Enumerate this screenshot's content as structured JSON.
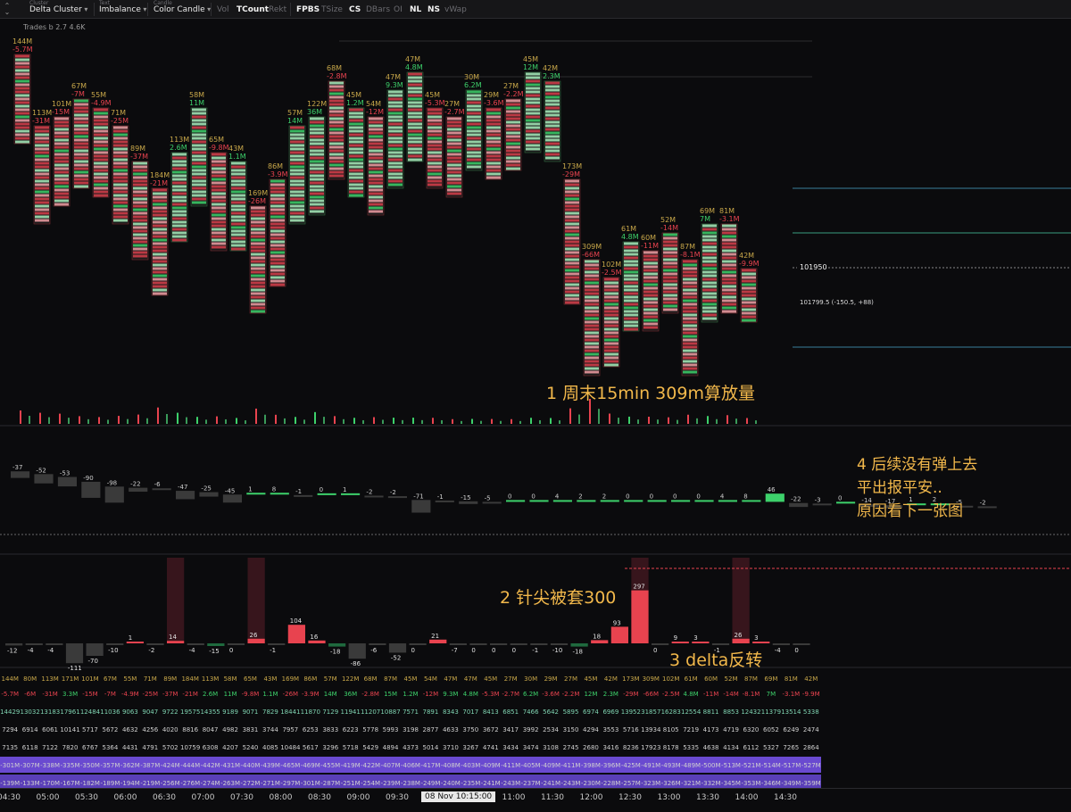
{
  "toolbar": {
    "groups": [
      {
        "caption": "Cluster",
        "value": "Delta Cluster"
      },
      {
        "caption": "Text",
        "value": "Imbalance"
      },
      {
        "caption": "Candle",
        "value": "Color Candle"
      }
    ],
    "toggles": [
      {
        "label": "Vol",
        "active": false
      },
      {
        "label": "TCount",
        "active": true
      },
      {
        "label": "Rekt",
        "active": false
      },
      {
        "label": "FPBS",
        "active": true
      },
      {
        "label": "TSize",
        "active": false
      },
      {
        "label": "CS",
        "active": true
      },
      {
        "label": "DBars",
        "active": false
      },
      {
        "label": "OI",
        "active": false
      },
      {
        "label": "NL",
        "active": true
      },
      {
        "label": "NS",
        "active": true
      },
      {
        "label": "vWap",
        "active": false
      }
    ]
  },
  "legend_text": "Trades b  2.7  4.6K",
  "price_labels": {
    "current": "101950",
    "crosshair": "101799.5 (-150.5, +88)"
  },
  "annotations": {
    "a1": "1 周末15min 309m算放量",
    "a2": "2 针尖被套300",
    "a3": "3 delta反转",
    "a4_line1": "4 后续没有弹上去",
    "a4_line2": "平出报平安..",
    "a4_line3": "原因看下一张图"
  },
  "colors": {
    "up": "#3dd16b",
    "down": "#e8434f",
    "accent": "#f2b84b",
    "purple": "#7d5bd6"
  },
  "chart_data": {
    "type": "footprint",
    "bars": [
      {
        "vol": "144M",
        "delta": "-5.7M",
        "high": 40,
        "low": 140
      },
      {
        "vol": "113M",
        "delta": "-31M",
        "high": 120,
        "low": 230
      },
      {
        "vol": "101M",
        "delta": "-15M",
        "high": 110,
        "low": 210
      },
      {
        "vol": "67M",
        "delta": "-7M",
        "high": 90,
        "low": 190
      },
      {
        "vol": "55M",
        "delta": "-4.9M",
        "high": 100,
        "low": 200
      },
      {
        "vol": "71M",
        "delta": "-25M",
        "high": 120,
        "low": 230
      },
      {
        "vol": "89M",
        "delta": "-37M",
        "high": 160,
        "low": 270
      },
      {
        "vol": "184M",
        "delta": "-21M",
        "high": 190,
        "low": 310
      },
      {
        "vol": "113M",
        "delta": "2.6M",
        "high": 150,
        "low": 250
      },
      {
        "vol": "58M",
        "delta": "11M",
        "high": 100,
        "low": 210
      },
      {
        "vol": "65M",
        "delta": "-9.8M",
        "high": 150,
        "low": 260
      },
      {
        "vol": "43M",
        "delta": "1.1M",
        "high": 160,
        "low": 260
      },
      {
        "vol": "169M",
        "delta": "-26M",
        "high": 210,
        "low": 330
      },
      {
        "vol": "86M",
        "delta": "-3.9M",
        "high": 180,
        "low": 300
      },
      {
        "vol": "57M",
        "delta": "14M",
        "high": 120,
        "low": 230
      },
      {
        "vol": "122M",
        "delta": "36M",
        "high": 110,
        "low": 220
      },
      {
        "vol": "68M",
        "delta": "-2.8M",
        "high": 70,
        "low": 180
      },
      {
        "vol": "45M",
        "delta": "1.2M",
        "high": 100,
        "low": 200
      },
      {
        "vol": "54M",
        "delta": "-12M",
        "high": 110,
        "low": 220
      },
      {
        "vol": "47M",
        "delta": "9.3M",
        "high": 80,
        "low": 190
      },
      {
        "vol": "47M",
        "delta": "4.8M",
        "high": 60,
        "low": 160
      },
      {
        "vol": "45M",
        "delta": "-5.3M",
        "high": 100,
        "low": 190
      },
      {
        "vol": "27M",
        "delta": "-2.7M",
        "high": 110,
        "low": 200
      },
      {
        "vol": "30M",
        "delta": "6.2M",
        "high": 80,
        "low": 170
      },
      {
        "vol": "29M",
        "delta": "-3.6M",
        "high": 100,
        "low": 180
      },
      {
        "vol": "27M",
        "delta": "-2.2M",
        "high": 90,
        "low": 170
      },
      {
        "vol": "45M",
        "delta": "12M",
        "high": 60,
        "low": 150
      },
      {
        "vol": "42M",
        "delta": "2.3M",
        "high": 70,
        "low": 160
      },
      {
        "vol": "173M",
        "delta": "-29M",
        "high": 180,
        "low": 320
      },
      {
        "vol": "309M",
        "delta": "-66M",
        "high": 270,
        "low": 400
      },
      {
        "vol": "102M",
        "delta": "-2.5M",
        "high": 290,
        "low": 390
      },
      {
        "vol": "61M",
        "delta": "4.8M",
        "high": 250,
        "low": 350
      },
      {
        "vol": "60M",
        "delta": "-11M",
        "high": 260,
        "low": 350
      },
      {
        "vol": "52M",
        "delta": "-14M",
        "high": 240,
        "low": 330
      },
      {
        "vol": "87M",
        "delta": "-8.1M",
        "high": 270,
        "low": 400
      },
      {
        "vol": "69M",
        "delta": "7M",
        "high": 230,
        "low": 340
      },
      {
        "vol": "81M",
        "delta": "-3.1M",
        "high": 230,
        "low": 330
      },
      {
        "vol": "42M",
        "delta": "-9.9M",
        "high": 280,
        "low": 340
      }
    ],
    "cvd_values": [
      "-37",
      "-52",
      "-53",
      "-90",
      "-98",
      "-22",
      "-6",
      "-47",
      "-25",
      "-45",
      "1",
      "8",
      "-1",
      "0",
      "1",
      "-2",
      "-2",
      "-71",
      "-1",
      "-15",
      "-5",
      "0",
      "0",
      "4",
      "2",
      "2",
      "0",
      "0",
      "0",
      "0",
      "4",
      "8",
      "46",
      "-22",
      "-3",
      "0",
      "-14",
      "-17",
      "1",
      "2",
      "-5",
      "-2"
    ],
    "delta_values": [
      "-12",
      "-4",
      "-4",
      "-111",
      "-70",
      "-10",
      "1",
      "-2",
      "14",
      "-4",
      "-15",
      "0",
      "26",
      "-1",
      "104",
      "16",
      "-18",
      "-86",
      "-6",
      "-52",
      "0",
      "21",
      "-7",
      "0",
      "0",
      "0",
      "-1",
      "-10",
      "-18",
      "18",
      "93",
      "297",
      "0",
      "9",
      "3",
      "-1",
      "26",
      "3",
      "-4",
      "0"
    ],
    "table": {
      "columns": [
        "144M",
        "80M",
        "113M",
        "171M",
        "101M",
        "67M",
        "55M",
        "71M",
        "89M",
        "184M",
        "113M",
        "58M",
        "65M",
        "43M",
        "169M",
        "86M",
        "57M",
        "122M",
        "68M",
        "87M",
        "45M",
        "54M",
        "47M",
        "47M",
        "45M",
        "27M",
        "30M",
        "29M",
        "27M",
        "45M",
        "42M",
        "173M",
        "309M",
        "102M",
        "61M",
        "60M",
        "52M",
        "87M",
        "69M",
        "81M",
        "42M"
      ],
      "rows": [
        [
          "-5.7M",
          "-6M",
          "-31M",
          "3.3M",
          "-15M",
          "-7M",
          "-4.9M",
          "-25M",
          "-37M",
          "-21M",
          "2.6M",
          "11M",
          "-9.8M",
          "1.1M",
          "-26M",
          "-3.9M",
          "14M",
          "36M",
          "-2.8M",
          "15M",
          "1.2M",
          "-12M",
          "9.3M",
          "4.8M",
          "-5.3M",
          "-2.7M",
          "6.2M",
          "-3.6M",
          "-2.2M",
          "12M",
          "2.3M",
          "-29M",
          "-66M",
          "-2.5M",
          "4.8M",
          "-11M",
          "-14M",
          "-8.1M",
          "7M",
          "-3.1M",
          "-9.9M"
        ],
        [
          "14429",
          "13032",
          "13183",
          "17961",
          "12484",
          "11036",
          "9063",
          "9047",
          "9722",
          "19575",
          "14355",
          "9189",
          "9071",
          "7829",
          "18441",
          "11870",
          "7129",
          "11941",
          "11207",
          "10887",
          "7571",
          "7891",
          "8343",
          "7017",
          "8413",
          "6851",
          "7466",
          "5642",
          "5895",
          "6974",
          "6969",
          "13952",
          "31857",
          "16283",
          "12554",
          "8811",
          "8853",
          "12432",
          "11379",
          "13514",
          "5338"
        ],
        [
          "7294",
          "6914",
          "6061",
          "10141",
          "5717",
          "5672",
          "4632",
          "4256",
          "4020",
          "8816",
          "8047",
          "4982",
          "3831",
          "3744",
          "7957",
          "6253",
          "3833",
          "6223",
          "5778",
          "5993",
          "3198",
          "2877",
          "4633",
          "3750",
          "3672",
          "3417",
          "3992",
          "2534",
          "3150",
          "4294",
          "3553",
          "5716",
          "13934",
          "8105",
          "7219",
          "4173",
          "4719",
          "6320",
          "6052",
          "6249",
          "2474"
        ],
        [
          "7135",
          "6118",
          "7122",
          "7820",
          "6767",
          "5364",
          "4431",
          "4791",
          "5702",
          "10759",
          "6308",
          "4207",
          "5240",
          "4085",
          "10484",
          "5617",
          "3296",
          "5718",
          "5429",
          "4894",
          "4373",
          "5014",
          "3710",
          "3267",
          "4741",
          "3434",
          "3474",
          "3108",
          "2745",
          "2680",
          "3416",
          "8236",
          "17923",
          "8178",
          "5335",
          "4638",
          "4134",
          "6112",
          "5327",
          "7265",
          "2864"
        ],
        [
          "-301M",
          "-307M",
          "-338M",
          "-335M",
          "-350M",
          "-357M",
          "-362M",
          "-387M",
          "-424M",
          "-444M",
          "-442M",
          "-431M",
          "-440M",
          "-439M",
          "-465M",
          "-469M",
          "-455M",
          "-419M",
          "-422M",
          "-407M",
          "-406M",
          "-417M",
          "-408M",
          "-403M",
          "-409M",
          "-411M",
          "-405M",
          "-409M",
          "-411M",
          "-398M",
          "-396M",
          "-425M",
          "-491M",
          "-493M",
          "-489M",
          "-500M",
          "-513M",
          "-521M",
          "-514M",
          "-517M",
          "-527M"
        ],
        [
          "-139M",
          "-133M",
          "-170M",
          "-167M",
          "-182M",
          "-189M",
          "-194M",
          "-219M",
          "-256M",
          "-276M",
          "-274M",
          "-263M",
          "-272M",
          "-271M",
          "-297M",
          "-301M",
          "-287M",
          "-251M",
          "-254M",
          "-239M",
          "-238M",
          "-249M",
          "-240M",
          "-235M",
          "-241M",
          "-243M",
          "-237M",
          "-241M",
          "-243M",
          "-230M",
          "-228M",
          "-257M",
          "-323M",
          "-326M",
          "-321M",
          "-332M",
          "-345M",
          "-353M",
          "-346M",
          "-349M",
          "-359M"
        ]
      ]
    },
    "time_labels": [
      "04:30",
      "05:00",
      "05:30",
      "06:00",
      "06:30",
      "07:00",
      "07:30",
      "08:00",
      "08:30",
      "09:00",
      "09:30",
      "10:00",
      "08 Nov 10:15:00",
      "11:00",
      "11:30",
      "12:00",
      "12:30",
      "13:00",
      "13:30",
      "14:00",
      "14:30"
    ],
    "time_cursor": "08 Nov 10:15:00"
  }
}
